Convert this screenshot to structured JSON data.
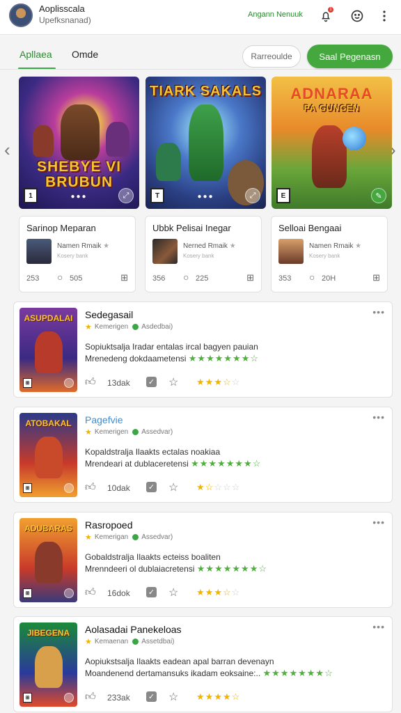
{
  "header": {
    "app_title": "Aoplisscala",
    "app_subtitle": "Upefksnanad)",
    "link": "Angann Nenuuk",
    "notif_count": "1",
    "icons": [
      "bell-icon",
      "smiley-icon",
      "more-vertical-icon"
    ]
  },
  "tabs": [
    {
      "label": "Apllaea",
      "active": true
    },
    {
      "label": "Omde",
      "active": false
    }
  ],
  "actions": {
    "outline_label": "Rarreoulde",
    "primary_label": "Saal Pegenasn",
    "primary_color": "#45a83f"
  },
  "featured": [
    {
      "art_title_line1": "SHEBYE VI",
      "art_title_line2": "BRUBUN",
      "card_title": "Sarinop Meparan",
      "dev": "Namen Rmaik",
      "dev_sub": "Kosery bank",
      "count": "253",
      "comments": "505",
      "badge": "1"
    },
    {
      "art_title_line1": "TIARK SAKALS",
      "art_title_line2": "",
      "card_title": "Ubbk Pelisai Inegar",
      "dev": "Nerned Rmaik",
      "dev_sub": "Kosery bank",
      "count": "356",
      "comments": "225",
      "badge": "T"
    },
    {
      "art_title_line1": "ADNARAA",
      "art_title_line2": "PA GUNCEN",
      "card_title": "Selloai Bengaai",
      "dev": "Namen Rmaik",
      "dev_sub": "Kosery bank",
      "count": "353",
      "comments": "20H",
      "badge": "E"
    }
  ],
  "list": [
    {
      "title": "Sedegasail",
      "thumb_title": "ASUPDALAI",
      "meta_a": "Kemerigen",
      "meta_b": "Asdedbai)",
      "desc1": "Sopiuktsalja Iradar entalas ircal bagyen pauian",
      "desc2": "Mrenedeng dokdaametensi",
      "likes": "13dak",
      "rating": 3.5,
      "title_color": "dark"
    },
    {
      "title": "Pagefvie",
      "thumb_title": "ATOBAKAL",
      "meta_a": "Kemerigen",
      "meta_b": "Assedvar)",
      "desc1": "Kopaldstralja Ilaakts ectalas noakiaa",
      "desc2": "Mrendeari at dublaceretensi",
      "likes": "10dak",
      "rating": 1.5,
      "title_color": "blue"
    },
    {
      "title": "Rasropoed",
      "thumb_title": "ADUBARAS",
      "meta_a": "Kemerigan",
      "meta_b": "Assedvar)",
      "desc1": "Gobaldstralja Ilaakts ecteiss boaliten",
      "desc2": "Mrenndeeri ol dublaiacretensi",
      "likes": "16dok",
      "rating": 3.5,
      "title_color": "dark"
    },
    {
      "title": "Aolasadai Panekeloas",
      "thumb_title": "JIBEGENA",
      "meta_a": "Kemaenan",
      "meta_b": "Assetdbai)",
      "desc1": "Aopiukstsalja Ilaakts eadean apal barran devenayn",
      "desc2": "Moandenend dertamansuks ikadam eoksaine:..",
      "likes": "233ak",
      "rating": 4.5,
      "title_color": "dark"
    }
  ]
}
